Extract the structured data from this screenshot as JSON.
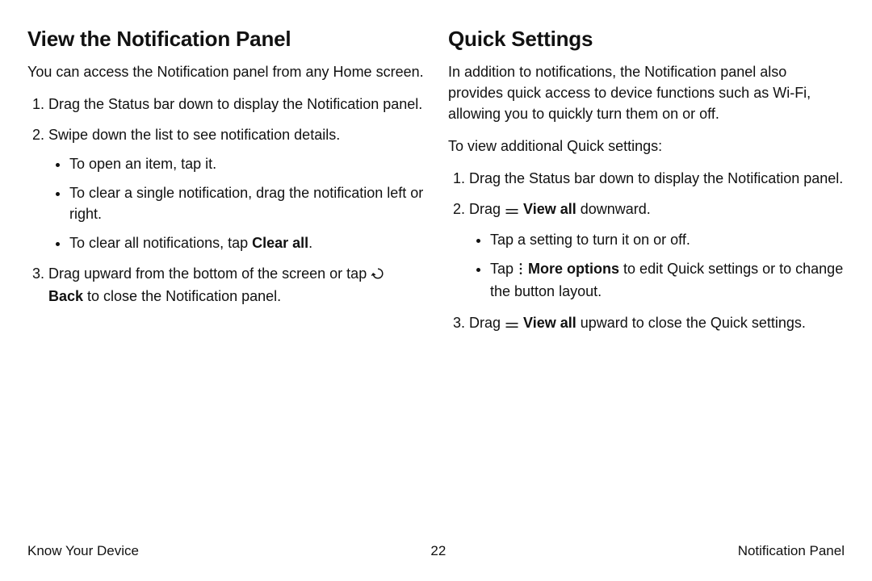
{
  "left": {
    "heading": "View the Notification Panel",
    "intro": "You can access the Notification panel from any Home screen.",
    "step1": "Drag the Status bar down to display the Notification panel.",
    "step2": "Swipe down the list to see notification details.",
    "s2a": "To open an item, tap it.",
    "s2b": "To clear a single notification, drag the notification left or right.",
    "s2c_pre": "To clear all notifications, tap ",
    "s2c_bold": "Clear all",
    "s2c_post": ".",
    "step3_pre": "Drag upward from the bottom of the screen or tap ",
    "step3_bold": "Back",
    "step3_post": " to close the Notification panel."
  },
  "right": {
    "heading": "Quick Settings",
    "intro": "In addition to notifications, the Notification panel also provides quick access to device functions such as Wi‑Fi, allowing you to quickly turn them on or off.",
    "lead": "To view additional Quick settings:",
    "step1": "Drag the Status bar down to display the Notification panel.",
    "step2_pre": "Drag ",
    "step2_bold": "View all",
    "step2_post": " downward.",
    "s2a": "Tap a setting to turn it on or off.",
    "s2b_pre": "Tap ",
    "s2b_bold": "More options",
    "s2b_post": " to edit Quick settings or to change the button layout.",
    "step3_pre": "Drag ",
    "step3_bold": "View all",
    "step3_post": " upward to close the Quick settings."
  },
  "footer": {
    "left": "Know Your Device",
    "center": "22",
    "right": "Notification Panel"
  }
}
